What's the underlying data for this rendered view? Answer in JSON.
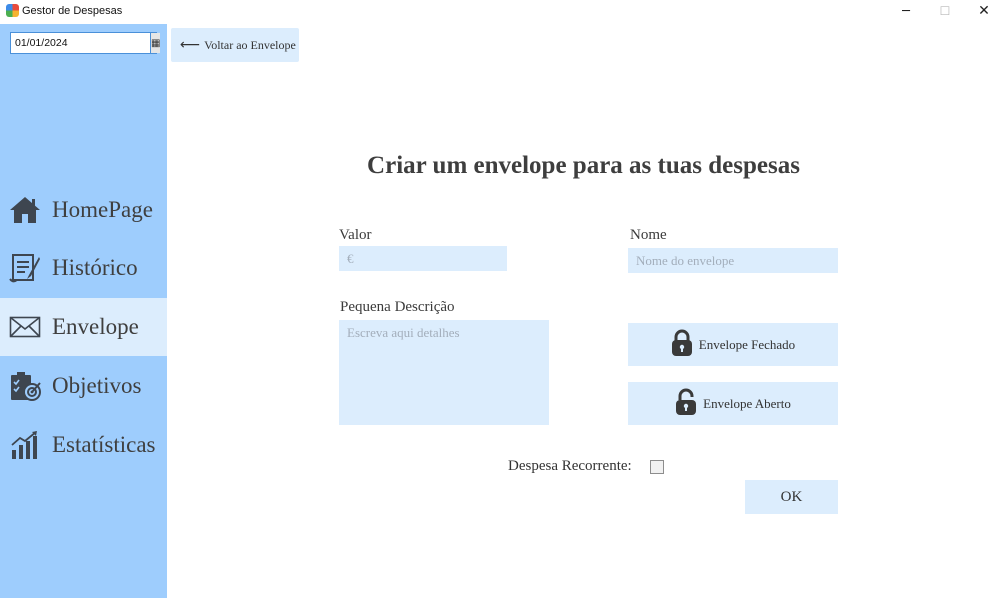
{
  "window": {
    "title": "Gestor de Despesas",
    "minimize": "─",
    "maximize": "☐",
    "close": "✕"
  },
  "sidebar": {
    "date_value": "01/01/2024",
    "calendar_glyph": "▦",
    "items": [
      {
        "label": "HomePage",
        "icon": "home-icon"
      },
      {
        "label": "Histórico",
        "icon": "history-icon"
      },
      {
        "label": "Envelope",
        "icon": "envelope-icon",
        "active": true
      },
      {
        "label": "Objetivos",
        "icon": "goals-icon"
      },
      {
        "label": "Estatísticas",
        "icon": "chart-icon"
      }
    ]
  },
  "back": {
    "arrow": "⟵",
    "label": "Voltar ao Envelope"
  },
  "form": {
    "title": "Criar um envelope para as tuas despesas",
    "valor_label": "Valor",
    "valor_placeholder": "€",
    "nome_label": "Nome",
    "nome_placeholder": "Nome do envelope",
    "descricao_label": "Pequena Descrição",
    "descricao_placeholder": "Escreva aqui detalhes",
    "closed_label": "Envelope Fechado",
    "open_label": "Envelope Aberto",
    "recurrent_label": "Despesa Recorrente:",
    "recurrent_checked": false,
    "ok_label": "OK"
  },
  "colors": {
    "sidebar": "#9ecdfd",
    "accent_light": "#dcedfd",
    "icon": "#3e4650"
  }
}
